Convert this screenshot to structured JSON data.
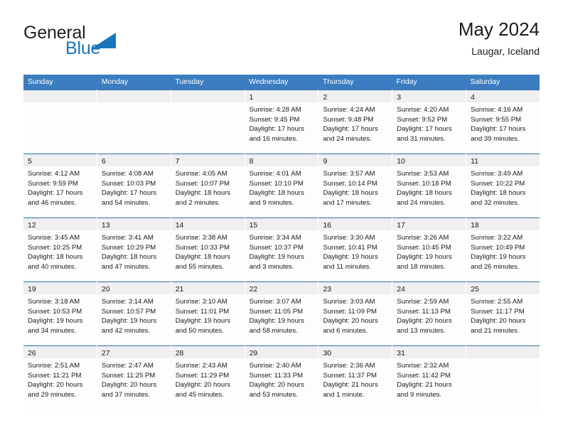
{
  "brand": {
    "word1": "General",
    "word2": "Blue",
    "logo_icon": "triangle-icon",
    "color_primary": "#1c75bc",
    "color_text": "#231f20"
  },
  "header": {
    "title": "May 2024",
    "subtitle": "Laugar, Iceland"
  },
  "calendar": {
    "header_bg": "#3b7dc0",
    "cell_top_border": "#2f6fb0",
    "daynum_bg": "#efefef",
    "weekdays": [
      "Sunday",
      "Monday",
      "Tuesday",
      "Wednesday",
      "Thursday",
      "Friday",
      "Saturday"
    ],
    "weeks": [
      [
        {
          "day": "",
          "lines": []
        },
        {
          "day": "",
          "lines": []
        },
        {
          "day": "",
          "lines": []
        },
        {
          "day": "1",
          "lines": [
            "Sunrise: 4:28 AM",
            "Sunset: 9:45 PM",
            "Daylight: 17 hours",
            "and 16 minutes."
          ]
        },
        {
          "day": "2",
          "lines": [
            "Sunrise: 4:24 AM",
            "Sunset: 9:48 PM",
            "Daylight: 17 hours",
            "and 24 minutes."
          ]
        },
        {
          "day": "3",
          "lines": [
            "Sunrise: 4:20 AM",
            "Sunset: 9:52 PM",
            "Daylight: 17 hours",
            "and 31 minutes."
          ]
        },
        {
          "day": "4",
          "lines": [
            "Sunrise: 4:16 AM",
            "Sunset: 9:55 PM",
            "Daylight: 17 hours",
            "and 39 minutes."
          ]
        }
      ],
      [
        {
          "day": "5",
          "lines": [
            "Sunrise: 4:12 AM",
            "Sunset: 9:59 PM",
            "Daylight: 17 hours",
            "and 46 minutes."
          ]
        },
        {
          "day": "6",
          "lines": [
            "Sunrise: 4:08 AM",
            "Sunset: 10:03 PM",
            "Daylight: 17 hours",
            "and 54 minutes."
          ]
        },
        {
          "day": "7",
          "lines": [
            "Sunrise: 4:05 AM",
            "Sunset: 10:07 PM",
            "Daylight: 18 hours",
            "and 2 minutes."
          ]
        },
        {
          "day": "8",
          "lines": [
            "Sunrise: 4:01 AM",
            "Sunset: 10:10 PM",
            "Daylight: 18 hours",
            "and 9 minutes."
          ]
        },
        {
          "day": "9",
          "lines": [
            "Sunrise: 3:57 AM",
            "Sunset: 10:14 PM",
            "Daylight: 18 hours",
            "and 17 minutes."
          ]
        },
        {
          "day": "10",
          "lines": [
            "Sunrise: 3:53 AM",
            "Sunset: 10:18 PM",
            "Daylight: 18 hours",
            "and 24 minutes."
          ]
        },
        {
          "day": "11",
          "lines": [
            "Sunrise: 3:49 AM",
            "Sunset: 10:22 PM",
            "Daylight: 18 hours",
            "and 32 minutes."
          ]
        }
      ],
      [
        {
          "day": "12",
          "lines": [
            "Sunrise: 3:45 AM",
            "Sunset: 10:25 PM",
            "Daylight: 18 hours",
            "and 40 minutes."
          ]
        },
        {
          "day": "13",
          "lines": [
            "Sunrise: 3:41 AM",
            "Sunset: 10:29 PM",
            "Daylight: 18 hours",
            "and 47 minutes."
          ]
        },
        {
          "day": "14",
          "lines": [
            "Sunrise: 3:38 AM",
            "Sunset: 10:33 PM",
            "Daylight: 18 hours",
            "and 55 minutes."
          ]
        },
        {
          "day": "15",
          "lines": [
            "Sunrise: 3:34 AM",
            "Sunset: 10:37 PM",
            "Daylight: 19 hours",
            "and 3 minutes."
          ]
        },
        {
          "day": "16",
          "lines": [
            "Sunrise: 3:30 AM",
            "Sunset: 10:41 PM",
            "Daylight: 19 hours",
            "and 11 minutes."
          ]
        },
        {
          "day": "17",
          "lines": [
            "Sunrise: 3:26 AM",
            "Sunset: 10:45 PM",
            "Daylight: 19 hours",
            "and 18 minutes."
          ]
        },
        {
          "day": "18",
          "lines": [
            "Sunrise: 3:22 AM",
            "Sunset: 10:49 PM",
            "Daylight: 19 hours",
            "and 26 minutes."
          ]
        }
      ],
      [
        {
          "day": "19",
          "lines": [
            "Sunrise: 3:18 AM",
            "Sunset: 10:53 PM",
            "Daylight: 19 hours",
            "and 34 minutes."
          ]
        },
        {
          "day": "20",
          "lines": [
            "Sunrise: 3:14 AM",
            "Sunset: 10:57 PM",
            "Daylight: 19 hours",
            "and 42 minutes."
          ]
        },
        {
          "day": "21",
          "lines": [
            "Sunrise: 3:10 AM",
            "Sunset: 11:01 PM",
            "Daylight: 19 hours",
            "and 50 minutes."
          ]
        },
        {
          "day": "22",
          "lines": [
            "Sunrise: 3:07 AM",
            "Sunset: 11:05 PM",
            "Daylight: 19 hours",
            "and 58 minutes."
          ]
        },
        {
          "day": "23",
          "lines": [
            "Sunrise: 3:03 AM",
            "Sunset: 11:09 PM",
            "Daylight: 20 hours",
            "and 6 minutes."
          ]
        },
        {
          "day": "24",
          "lines": [
            "Sunrise: 2:59 AM",
            "Sunset: 11:13 PM",
            "Daylight: 20 hours",
            "and 13 minutes."
          ]
        },
        {
          "day": "25",
          "lines": [
            "Sunrise: 2:55 AM",
            "Sunset: 11:17 PM",
            "Daylight: 20 hours",
            "and 21 minutes."
          ]
        }
      ],
      [
        {
          "day": "26",
          "lines": [
            "Sunrise: 2:51 AM",
            "Sunset: 11:21 PM",
            "Daylight: 20 hours",
            "and 29 minutes."
          ]
        },
        {
          "day": "27",
          "lines": [
            "Sunrise: 2:47 AM",
            "Sunset: 11:25 PM",
            "Daylight: 20 hours",
            "and 37 minutes."
          ]
        },
        {
          "day": "28",
          "lines": [
            "Sunrise: 2:43 AM",
            "Sunset: 11:29 PM",
            "Daylight: 20 hours",
            "and 45 minutes."
          ]
        },
        {
          "day": "29",
          "lines": [
            "Sunrise: 2:40 AM",
            "Sunset: 11:33 PM",
            "Daylight: 20 hours",
            "and 53 minutes."
          ]
        },
        {
          "day": "30",
          "lines": [
            "Sunrise: 2:36 AM",
            "Sunset: 11:37 PM",
            "Daylight: 21 hours",
            "and 1 minute."
          ]
        },
        {
          "day": "31",
          "lines": [
            "Sunrise: 2:32 AM",
            "Sunset: 11:42 PM",
            "Daylight: 21 hours",
            "and 9 minutes."
          ]
        },
        {
          "day": "",
          "lines": []
        }
      ]
    ]
  }
}
